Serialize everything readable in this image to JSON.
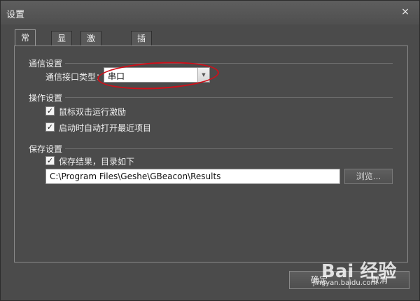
{
  "window": {
    "title": "设置",
    "close_glyph": "×"
  },
  "tabs": [
    {
      "label": "常规",
      "active": true
    },
    {
      "label": "显示",
      "active": false
    },
    {
      "label": "激励工程",
      "active": false
    },
    {
      "label": "插件",
      "active": false
    }
  ],
  "comm": {
    "group_title": "通信设置",
    "interface_label": "通信接口类型：",
    "interface_value": "串口"
  },
  "operation": {
    "group_title": "操作设置",
    "dblclick": {
      "label": "鼠标双击运行激励",
      "checked": true
    },
    "autoopen": {
      "label": "启动时自动打开最近项目",
      "checked": true
    }
  },
  "save": {
    "group_title": "保存设置",
    "save_results": {
      "label": "保存结果，目录如下",
      "checked": true
    },
    "path": "C:\\Program Files\\Geshe\\GBeacon\\Results",
    "browse_label": "浏览..."
  },
  "footer": {
    "ok_label": "确定",
    "cancel_label": "取消"
  },
  "watermark": {
    "brand": "Bai 经验",
    "url": "jingyan.baidu.com"
  },
  "icons": {
    "close": "close-icon",
    "checkbox": "check-icon",
    "dropdown": "chevron-down-icon"
  }
}
